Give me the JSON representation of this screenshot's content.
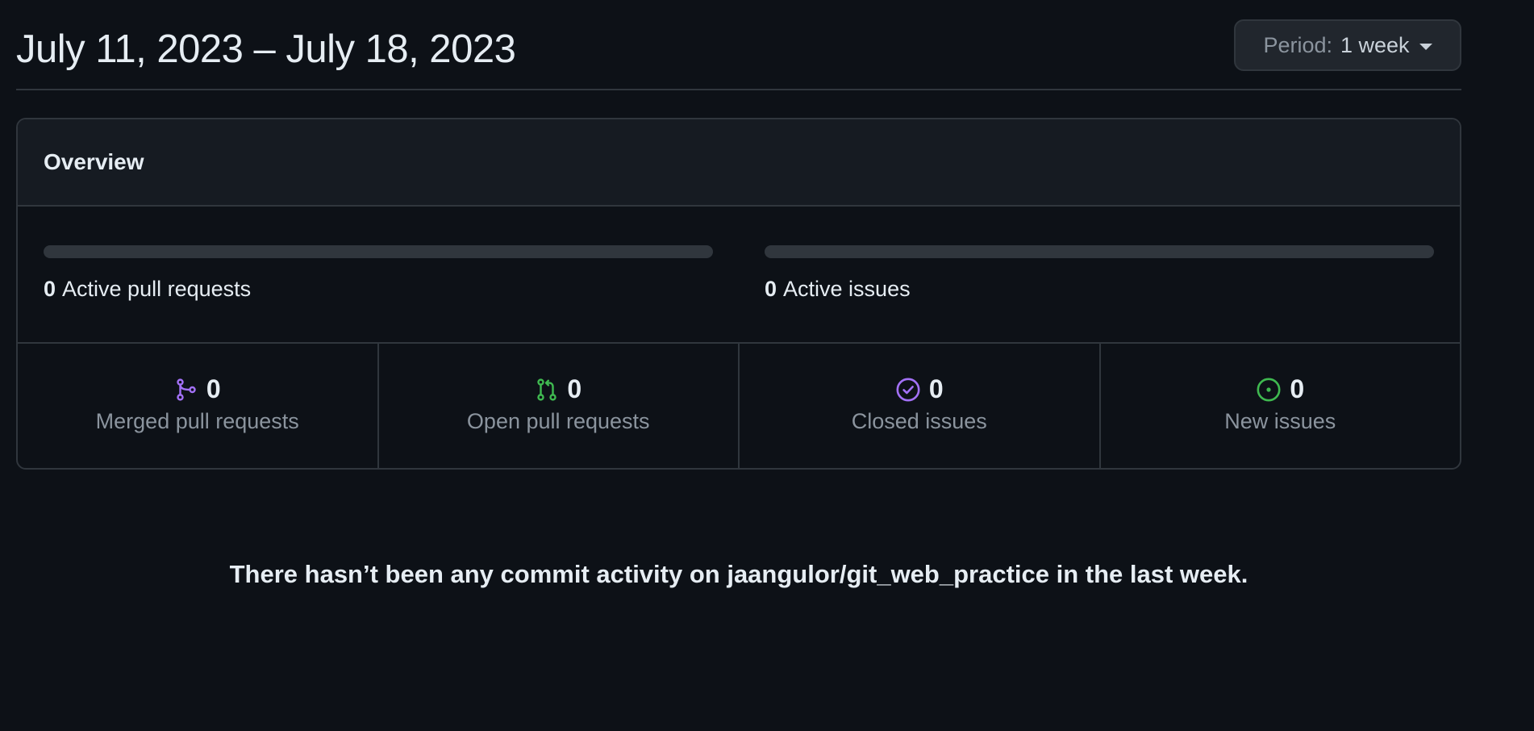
{
  "header": {
    "date_range": "July 11, 2023 – July 18, 2023",
    "period_label": "Period:",
    "period_value": "1 week"
  },
  "overview": {
    "title": "Overview",
    "active_pull_requests": {
      "count": "0",
      "label": "Active pull requests",
      "progress": 0
    },
    "active_issues": {
      "count": "0",
      "label": "Active issues",
      "progress": 0
    },
    "stats": [
      {
        "icon": "git-merge-icon",
        "count": "0",
        "label": "Merged pull requests",
        "color": "#a371f7"
      },
      {
        "icon": "git-pull-request-icon",
        "count": "0",
        "label": "Open pull requests",
        "color": "#3fb950"
      },
      {
        "icon": "issue-closed-icon",
        "count": "0",
        "label": "Closed issues",
        "color": "#a371f7"
      },
      {
        "icon": "issue-opened-icon",
        "count": "0",
        "label": "New issues",
        "color": "#3fb950"
      }
    ]
  },
  "commit_activity": {
    "message": "There hasn’t been any commit activity on jaangulor/git_web_practice in the last week."
  },
  "colors": {
    "background": "#0d1117",
    "border": "#30363d",
    "header_bg": "#161b22",
    "text": "#e6edf3",
    "muted": "#8b949e",
    "purple": "#a371f7",
    "green": "#3fb950"
  }
}
